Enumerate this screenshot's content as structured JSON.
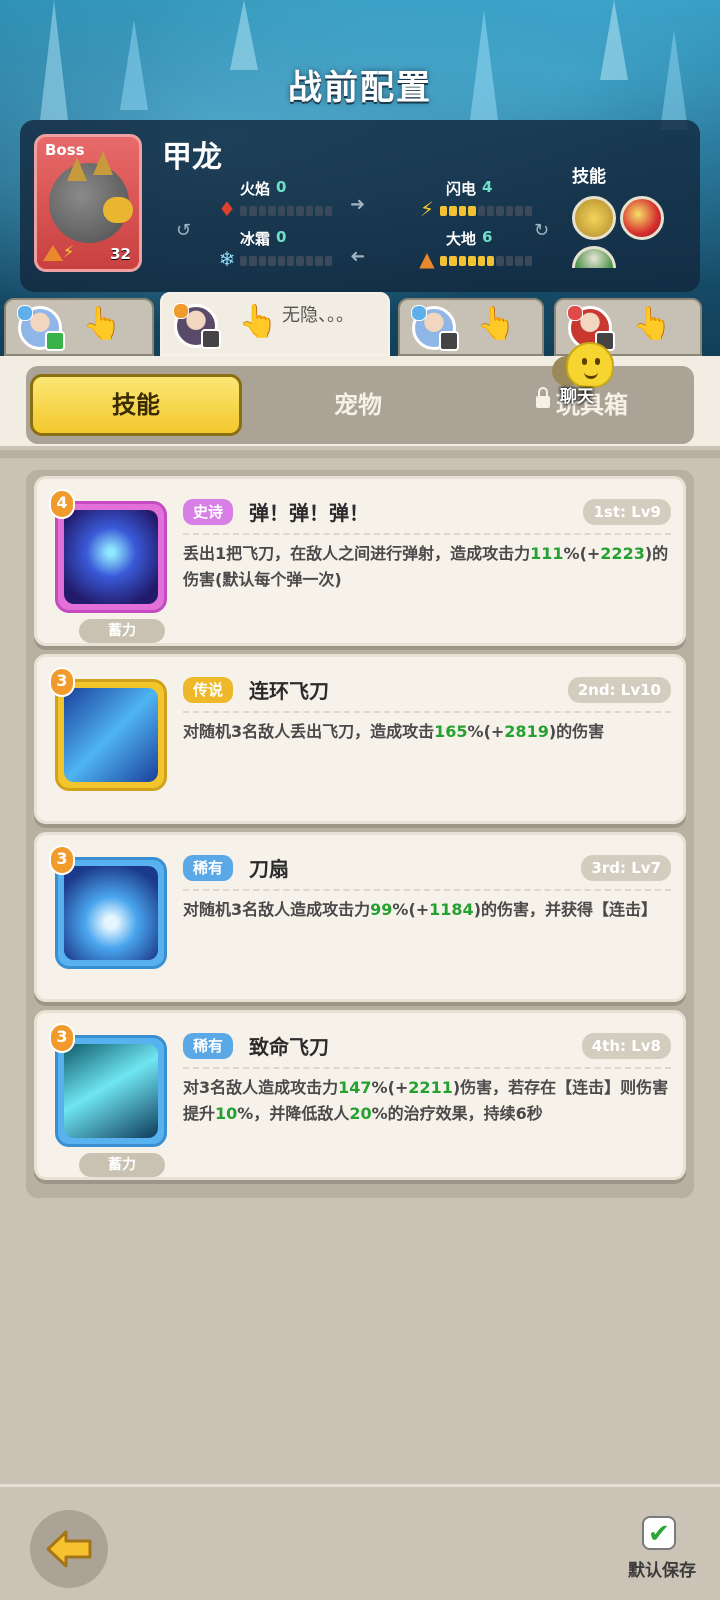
{
  "title": "战前配置",
  "boss": {
    "tag": "Boss",
    "name": "甲龙",
    "level": "32",
    "stats": {
      "fire": {
        "label": "火焰",
        "value": "0",
        "level": 0
      },
      "lightning": {
        "label": "闪电",
        "value": "4",
        "level": 4
      },
      "frost": {
        "label": "冰霜",
        "value": "0",
        "level": 0
      },
      "earth": {
        "label": "大地",
        "value": "6",
        "level": 6
      }
    },
    "stat_bar_max": 10,
    "skills_label": "技能"
  },
  "heroes": [
    {
      "name": "hero-1",
      "active": false,
      "message": ""
    },
    {
      "name": "hero-2",
      "active": true,
      "message": "无隐、。。"
    },
    {
      "name": "hero-3",
      "active": false,
      "message": ""
    },
    {
      "name": "hero-4",
      "active": false,
      "message": ""
    }
  ],
  "chat": {
    "label": "聊天"
  },
  "tabs": {
    "skills": "技能",
    "pets": "宠物",
    "toybox": "玩具箱"
  },
  "skills": [
    {
      "rarity": "史诗",
      "rarity_color": "#d77fe6",
      "name": "弹！弹！弹！",
      "slot": "1st: Lv9",
      "badge": "4",
      "charge": "蓄力",
      "desc_1": "丢出1把飞刀，在敌人之间进行弹射，造成攻击力",
      "pct": "111",
      "desc_2": "%(+",
      "bonus": "2223",
      "desc_3": ")的伤害(默认每个弹一次)",
      "frame_color": "#e36fd8"
    },
    {
      "rarity": "传说",
      "rarity_color": "#efb82a",
      "name": "连环飞刀",
      "slot": "2nd: Lv10",
      "badge": "3",
      "charge": "",
      "desc_1": "对随机3名敌人丢出飞刀，造成攻击",
      "pct": "165",
      "desc_2": "%(+",
      "bonus": "2819",
      "desc_3": ")的伤害",
      "frame_color": "#f2c52d"
    },
    {
      "rarity": "稀有",
      "rarity_color": "#5aa8e6",
      "name": "刀扇",
      "slot": "3rd: Lv7",
      "badge": "3",
      "charge": "",
      "desc_1": "对随机3名敌人造成攻击力",
      "pct": "99",
      "desc_2": "%(+",
      "bonus": "1184",
      "desc_3": ")的伤害，并获得【连击】",
      "frame_color": "#58b2ef"
    },
    {
      "rarity": "稀有",
      "rarity_color": "#5aa8e6",
      "name": "致命飞刀",
      "slot": "4th: Lv8",
      "badge": "3",
      "charge": "蓄力",
      "desc_1": "对3名敌人造成攻击力",
      "pct": "147",
      "desc_2": "%(+",
      "bonus": "2211",
      "desc_3": ")伤害，若存在【连击】则伤害提升",
      "pct2": "10",
      "desc_4": "%，并降低敌人",
      "pct3": "20",
      "desc_5": "%的治疗效果，持续6秒",
      "frame_color": "#58b2ef"
    }
  ],
  "footer": {
    "save_label": "默认保存"
  }
}
